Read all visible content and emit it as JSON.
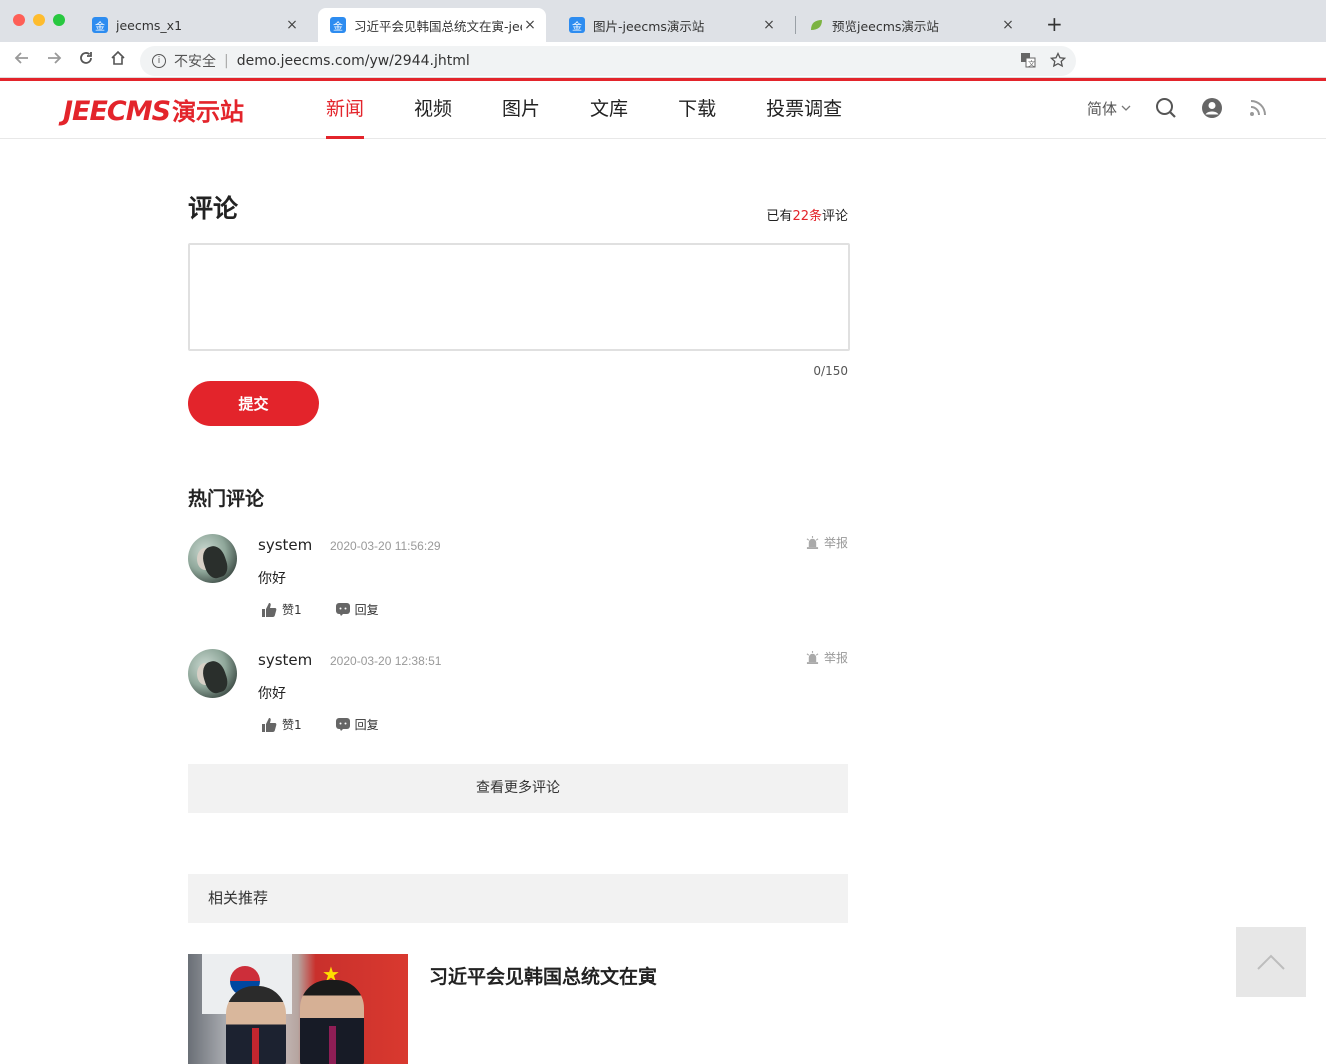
{
  "browser": {
    "tabs": [
      {
        "label": "jeecms_x1",
        "favicon": "金",
        "active": false
      },
      {
        "label": "习近平会见韩国总统文在寅-jeec",
        "favicon": "金",
        "active": true
      },
      {
        "label": "图片-jeecms演示站",
        "favicon": "金",
        "active": false
      },
      {
        "label": "预览jeecms演示站",
        "favicon": "leaf-icon",
        "active": false
      }
    ],
    "close_glyph": "×",
    "new_tab_glyph": "+",
    "omnibox": {
      "security_label": "不安全",
      "url": "demo.jeecms.com/yw/2944.jhtml"
    }
  },
  "site": {
    "logo": {
      "latin": "JEECMS",
      "cn": "演示站"
    },
    "nav": [
      {
        "label": "新闻",
        "active": true
      },
      {
        "label": "视频",
        "active": false
      },
      {
        "label": "图片",
        "active": false
      },
      {
        "label": "文库",
        "active": false
      },
      {
        "label": "下载",
        "active": false
      },
      {
        "label": "投票调查",
        "active": false
      }
    ],
    "language": "简体",
    "accent_color": "#e3242b"
  },
  "comments": {
    "title": "评论",
    "count_prefix": "已有",
    "count_value": "22条",
    "count_suffix": "评论",
    "textarea_value": "",
    "char_counter": "0/150",
    "submit_label": "提交",
    "hot_title": "热门评论",
    "items": [
      {
        "user": "system",
        "time": "2020-03-20 11:56:29",
        "text": "你好",
        "report_label": "举报",
        "like_label": "赞1",
        "reply_label": "回复"
      },
      {
        "user": "system",
        "time": "2020-03-20 12:38:51",
        "text": "你好",
        "report_label": "举报",
        "like_label": "赞1",
        "reply_label": "回复"
      }
    ],
    "more_label": "查看更多评论"
  },
  "related": {
    "title": "相关推荐",
    "items": [
      {
        "title": "习近平会见韩国总统文在寅"
      }
    ]
  }
}
